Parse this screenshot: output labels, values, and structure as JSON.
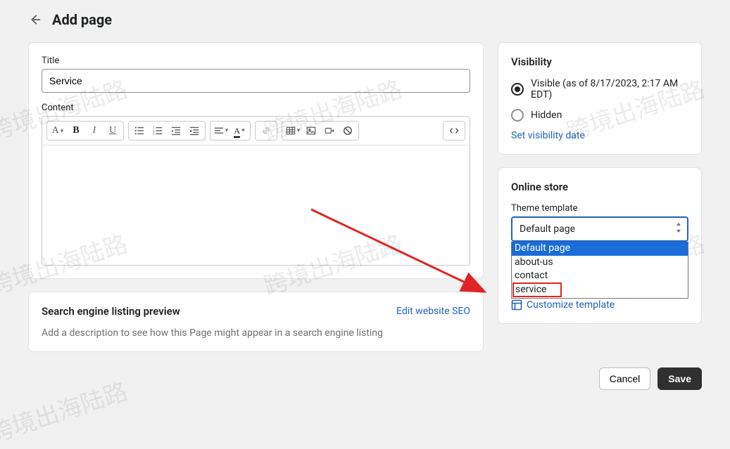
{
  "header": {
    "title": "Add page"
  },
  "main": {
    "title_label": "Title",
    "title_value": "Service",
    "content_label": "Content"
  },
  "seo": {
    "heading": "Search engine listing preview",
    "edit_link": "Edit website SEO",
    "description": "Add a description to see how this Page might appear in a search engine listing"
  },
  "visibility": {
    "heading": "Visibility",
    "visible_label": "Visible (as of 8/17/2023, 2:17 AM EDT)",
    "hidden_label": "Hidden",
    "set_date_link": "Set visibility date"
  },
  "online_store": {
    "heading": "Online store",
    "template_label": "Theme template",
    "selected": "Default page",
    "options": [
      "Default page",
      "about-us",
      "contact",
      "service"
    ],
    "customize_link": "Customize template"
  },
  "footer": {
    "cancel": "Cancel",
    "save": "Save"
  },
  "watermark": "跨境出海陆路"
}
